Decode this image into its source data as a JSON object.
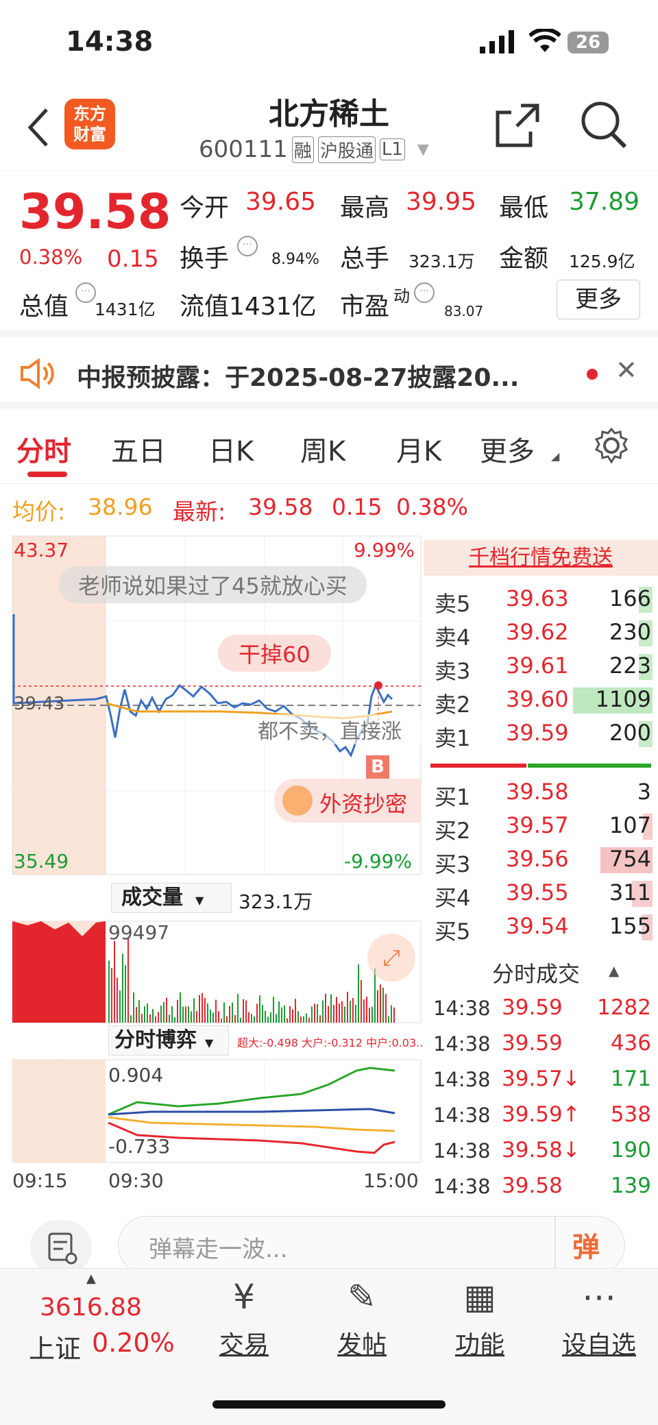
{
  "status": {
    "time": "14:38",
    "battery": "26"
  },
  "header": {
    "logo_line1": "东方",
    "logo_line2": "财富",
    "title": "北方稀土",
    "code": "600111",
    "tags": [
      "融",
      "沪股通",
      "L1"
    ]
  },
  "quote": {
    "price": "39.58",
    "pct": "0.38%",
    "chg": "0.15",
    "open_label": "今开",
    "open": "39.65",
    "high_label": "最高",
    "high": "39.95",
    "low_label": "最低",
    "low": "37.89",
    "turnover_label": "换手",
    "turnover": "8.94%",
    "vol_label": "总手",
    "vol": "323.1万",
    "amt_label": "金额",
    "amt": "125.9亿",
    "mcap_label": "总值",
    "mcap": "1431亿",
    "float_label": "流值1431亿",
    "pe_label": "市盈",
    "pe_sup": "动",
    "pe": "83.07",
    "more": "更多"
  },
  "notice": {
    "text": "中报预披露：于2025-08-27披露20..."
  },
  "tabs": [
    "分时",
    "五日",
    "日K",
    "周K",
    "月K",
    "更多"
  ],
  "avg": {
    "label": "均价:",
    "value": "38.96",
    "latest_label": "最新:",
    "latest": "39.58",
    "chg": "0.15",
    "pct": "0.38%"
  },
  "chart": {
    "top_price": "43.37",
    "top_pct": "9.99%",
    "bottom_price": "35.49",
    "bottom_pct": "-9.99%",
    "prev_close": "39.43",
    "bubble1": "老师说如果过了45就放心买",
    "bubble2": "干掉60",
    "bubble3": "都不卖，直接涨",
    "bubble4": "外资抄密",
    "marker": "B",
    "vol_select": "成交量",
    "vol_total": "323.1万",
    "vol_max": "99497",
    "game_select": "分时博弈",
    "game_legend": "超大:-0.498 大户:-0.312 中户:0.03...",
    "game_max": "0.904",
    "game_min": "-0.733",
    "time_labels": [
      "09:15",
      "09:30",
      "15:00"
    ]
  },
  "book": {
    "promo": "千档行情免费送",
    "asks": [
      {
        "label": "卖5",
        "price": "39.63",
        "vol": "166"
      },
      {
        "label": "卖4",
        "price": "39.62",
        "vol": "230"
      },
      {
        "label": "卖3",
        "price": "39.61",
        "vol": "223"
      },
      {
        "label": "卖2",
        "price": "39.60",
        "vol": "1109"
      },
      {
        "label": "卖1",
        "price": "39.59",
        "vol": "200"
      }
    ],
    "bids": [
      {
        "label": "买1",
        "price": "39.58",
        "vol": "3"
      },
      {
        "label": "买2",
        "price": "39.57",
        "vol": "107"
      },
      {
        "label": "买3",
        "price": "39.56",
        "vol": "754"
      },
      {
        "label": "买4",
        "price": "39.55",
        "vol": "311"
      },
      {
        "label": "买5",
        "price": "39.54",
        "vol": "155"
      }
    ],
    "ticks_title": "分时成交",
    "ticks": [
      {
        "t": "14:38",
        "p": "39.59",
        "v": "1282"
      },
      {
        "t": "14:38",
        "p": "39.59",
        "v": "436"
      },
      {
        "t": "14:38",
        "p": "39.57↓",
        "v": "171"
      },
      {
        "t": "14:38",
        "p": "39.59↑",
        "v": "538"
      },
      {
        "t": "14:38",
        "p": "39.58↓",
        "v": "190"
      },
      {
        "t": "14:38",
        "p": "39.58",
        "v": "139"
      }
    ]
  },
  "danmu": {
    "placeholder": "弹幕走一波...",
    "btn": "弹"
  },
  "bottom": {
    "index_value": "3616.88",
    "index_name": "上证",
    "index_pct": "0.20%",
    "items": [
      "交易",
      "发帖",
      "功能",
      "设自选"
    ]
  },
  "colors": {
    "up": "#e3262e",
    "down": "#1a9b33",
    "avg": "#f0a020",
    "line": "#3a6fc4"
  }
}
